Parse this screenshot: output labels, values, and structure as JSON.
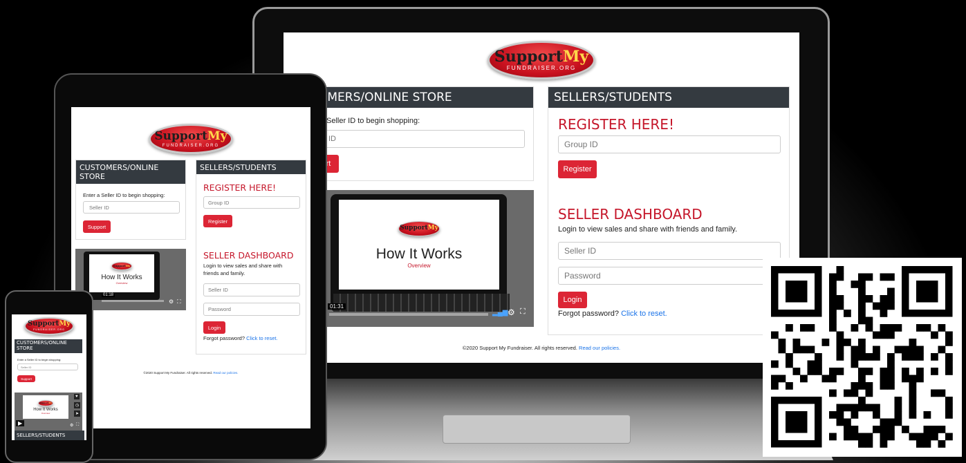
{
  "brand": {
    "logo_main_1": "Support",
    "logo_main_2": "My",
    "logo_sub": "FUNDRAISER.ORG"
  },
  "customers": {
    "title": "CUSTOMERS/ONLINE STORE",
    "laptop_title_cropped": "OMERS/ONLINE STORE",
    "instruction": "Enter a Seller ID to begin shopping:",
    "laptop_instruction_cropped": "Seller ID to begin shopping:",
    "seller_id_placeholder": "Seller ID",
    "laptop_input_cropped": "ID",
    "button": "Support",
    "laptop_button_cropped": "rt"
  },
  "sellers": {
    "title": "SELLERS/STUDENTS",
    "register_heading": "REGISTER HERE!",
    "group_id_placeholder": "Group ID",
    "register_button": "Register",
    "dashboard_heading": "SELLER DASHBOARD",
    "dashboard_text": "Login to view sales and share with friends and family.",
    "seller_id_placeholder": "Seller ID",
    "password_placeholder": "Password",
    "login_button": "Login",
    "forgot_text": "Forgot password?",
    "reset_link": "Click to reset."
  },
  "video": {
    "title": "How It Works",
    "subtitle": "Overview",
    "time_laptop": "01:31",
    "time_tablet": "01:18",
    "icons": [
      "volume-icon",
      "gear-icon",
      "fullscreen-icon"
    ]
  },
  "footer": {
    "copyright": "©2020 Support My Fundraiser. All rights reserved.",
    "policies_link": "Read our policies."
  },
  "colors": {
    "accent_red": "#dc2535",
    "header_dark": "#343a40",
    "link_blue": "#1a73e8"
  }
}
